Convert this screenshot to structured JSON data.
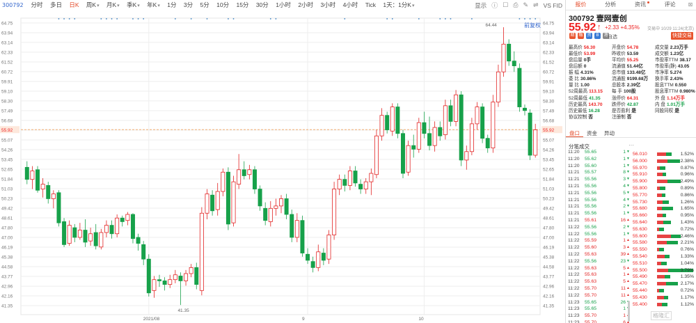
{
  "toolbar": {
    "code": "300792",
    "periods": [
      "分时",
      "多日",
      "日K",
      "周K",
      "月K",
      "季K",
      "年K",
      "1分",
      "3分",
      "5分",
      "10分",
      "15分",
      "30分",
      "1小时",
      "2小时",
      "3小时",
      "4小时",
      "Tick",
      "1天：1分K"
    ],
    "active_period": "日K",
    "display_label": "显示",
    "caret_periods": [
      "周K",
      "月K",
      "季K",
      "年K",
      "1天：1分K"
    ],
    "icons": [
      "info-icon",
      "camera-icon",
      "brush-icon",
      "compare-icon"
    ],
    "vs_label": "VS FID",
    "fuquan_label": "前复权"
  },
  "chart_data": {
    "type": "candlestick",
    "y_ticks": [
      "64.75",
      "63.94",
      "63.14",
      "62.33",
      "61.52",
      "60.72",
      "59.91",
      "59.10",
      "58.30",
      "57.49",
      "56.68",
      "55.88",
      "55.07",
      "54.26",
      "53.45",
      "52.65",
      "51.84",
      "51.03",
      "50.23",
      "49.42",
      "48.61",
      "47.80",
      "47.00",
      "46.19",
      "45.38",
      "44.58",
      "43.77",
      "42.96",
      "42.16",
      "41.35"
    ],
    "ylim": [
      41.35,
      64.75
    ],
    "x_labels": [
      "2021/08",
      "9",
      "10"
    ],
    "current_price_label": "55.92",
    "max_label": "64.44",
    "min_label": "41.35",
    "candles": [
      {
        "o": 52.8,
        "c": 51.8,
        "h": 53.3,
        "l": 51.4
      },
      {
        "o": 51.8,
        "c": 52.5,
        "h": 52.9,
        "l": 51.0
      },
      {
        "o": 52.6,
        "c": 50.9,
        "h": 52.9,
        "l": 50.7
      },
      {
        "o": 51.0,
        "c": 51.4,
        "h": 51.9,
        "l": 50.3
      },
      {
        "o": 51.3,
        "c": 50.2,
        "h": 51.6,
        "l": 49.8
      },
      {
        "o": 50.2,
        "c": 50.6,
        "h": 50.9,
        "l": 49.4
      },
      {
        "o": 50.7,
        "c": 48.2,
        "h": 50.9,
        "l": 47.9
      },
      {
        "o": 48.3,
        "c": 46.4,
        "h": 48.6,
        "l": 46.2
      },
      {
        "o": 46.5,
        "c": 48.0,
        "h": 48.4,
        "l": 46.3
      },
      {
        "o": 47.8,
        "c": 47.0,
        "h": 48.1,
        "l": 46.6
      },
      {
        "o": 47.0,
        "c": 47.6,
        "h": 48.2,
        "l": 46.8
      },
      {
        "o": 47.6,
        "c": 46.6,
        "h": 48.5,
        "l": 46.2
      },
      {
        "o": 46.7,
        "c": 47.3,
        "h": 47.8,
        "l": 46.3
      },
      {
        "o": 47.4,
        "c": 46.3,
        "h": 48.1,
        "l": 46.0
      },
      {
        "o": 46.2,
        "c": 47.4,
        "h": 47.7,
        "l": 46.0
      },
      {
        "o": 47.4,
        "c": 48.0,
        "h": 48.4,
        "l": 47.0
      },
      {
        "o": 48.0,
        "c": 47.3,
        "h": 48.4,
        "l": 46.9
      },
      {
        "o": 47.3,
        "c": 48.6,
        "h": 48.9,
        "l": 47.0
      },
      {
        "o": 48.6,
        "c": 48.3,
        "h": 48.8,
        "l": 47.9
      },
      {
        "o": 48.4,
        "c": 48.9,
        "h": 49.1,
        "l": 48.0
      },
      {
        "o": 48.9,
        "c": 46.9,
        "h": 49.0,
        "l": 46.5
      },
      {
        "o": 47.0,
        "c": 46.5,
        "h": 47.3,
        "l": 45.9
      },
      {
        "o": 46.4,
        "c": 45.2,
        "h": 46.7,
        "l": 44.7
      },
      {
        "o": 45.2,
        "c": 42.4,
        "h": 45.6,
        "l": 42.1
      },
      {
        "o": 42.6,
        "c": 43.5,
        "h": 43.8,
        "l": 42.0
      },
      {
        "o": 43.5,
        "c": 43.4,
        "h": 43.9,
        "l": 42.9
      },
      {
        "o": 43.4,
        "c": 43.1,
        "h": 43.7,
        "l": 42.6
      },
      {
        "o": 43.1,
        "c": 43.5,
        "h": 43.9,
        "l": 42.8
      },
      {
        "o": 43.5,
        "c": 43.9,
        "h": 44.3,
        "l": 43.2
      },
      {
        "o": 43.8,
        "c": 43.4,
        "h": 44.1,
        "l": 41.4
      },
      {
        "o": 43.4,
        "c": 44.0,
        "h": 44.3,
        "l": 43.0
      },
      {
        "o": 44.0,
        "c": 44.5,
        "h": 44.8,
        "l": 43.7
      },
      {
        "o": 44.5,
        "c": 43.1,
        "h": 44.9,
        "l": 42.7
      },
      {
        "o": 42.6,
        "c": 49.0,
        "h": 49.5,
        "l": 42.2
      },
      {
        "o": 49.0,
        "c": 50.6,
        "h": 51.0,
        "l": 48.5
      },
      {
        "o": 50.5,
        "c": 49.2,
        "h": 50.9,
        "l": 48.8
      },
      {
        "o": 49.3,
        "c": 50.8,
        "h": 51.5,
        "l": 48.8
      },
      {
        "o": 50.8,
        "c": 52.4,
        "h": 52.7,
        "l": 50.4
      },
      {
        "o": 52.4,
        "c": 48.1,
        "h": 52.8,
        "l": 47.6
      },
      {
        "o": 48.2,
        "c": 51.6,
        "h": 52.1,
        "l": 47.9
      },
      {
        "o": 51.4,
        "c": 52.6,
        "h": 53.9,
        "l": 51.0
      },
      {
        "o": 52.6,
        "c": 52.1,
        "h": 53.3,
        "l": 51.8
      },
      {
        "o": 52.2,
        "c": 52.6,
        "h": 53.0,
        "l": 51.8
      },
      {
        "o": 52.6,
        "c": 51.0,
        "h": 52.9,
        "l": 50.6
      },
      {
        "o": 51.0,
        "c": 49.6,
        "h": 51.3,
        "l": 49.2
      },
      {
        "o": 49.4,
        "c": 48.4,
        "h": 49.9,
        "l": 48.0
      },
      {
        "o": 48.3,
        "c": 49.4,
        "h": 50.0,
        "l": 47.9
      },
      {
        "o": 49.4,
        "c": 49.6,
        "h": 50.2,
        "l": 48.8
      },
      {
        "o": 49.6,
        "c": 50.2,
        "h": 50.5,
        "l": 49.0
      },
      {
        "o": 50.2,
        "c": 48.9,
        "h": 50.6,
        "l": 48.5
      },
      {
        "o": 48.9,
        "c": 47.0,
        "h": 49.3,
        "l": 46.6
      },
      {
        "o": 47.0,
        "c": 48.4,
        "h": 49.0,
        "l": 46.6
      },
      {
        "o": 48.4,
        "c": 45.7,
        "h": 48.8,
        "l": 45.4
      },
      {
        "o": 45.6,
        "c": 45.1,
        "h": 46.1,
        "l": 44.8
      },
      {
        "o": 45.0,
        "c": 44.5,
        "h": 45.4,
        "l": 44.1
      },
      {
        "o": 44.5,
        "c": 45.8,
        "h": 46.4,
        "l": 44.2
      },
      {
        "o": 45.7,
        "c": 45.1,
        "h": 46.1,
        "l": 44.7
      },
      {
        "o": 45.2,
        "c": 47.2,
        "h": 47.6,
        "l": 44.8
      },
      {
        "o": 47.2,
        "c": 51.0,
        "h": 51.6,
        "l": 46.8
      },
      {
        "o": 51.0,
        "c": 51.8,
        "h": 52.2,
        "l": 50.5
      },
      {
        "o": 51.8,
        "c": 51.3,
        "h": 52.2,
        "l": 50.8
      },
      {
        "o": 51.3,
        "c": 52.5,
        "h": 52.9,
        "l": 50.9
      },
      {
        "o": 52.5,
        "c": 51.5,
        "h": 52.9,
        "l": 51.2
      },
      {
        "o": 51.4,
        "c": 51.0,
        "h": 51.8,
        "l": 50.6
      },
      {
        "o": 51.0,
        "c": 51.6,
        "h": 51.9,
        "l": 50.6
      },
      {
        "o": 51.6,
        "c": 52.3,
        "h": 52.7,
        "l": 50.5
      },
      {
        "o": 52.2,
        "c": 55.4,
        "h": 55.9,
        "l": 51.9
      },
      {
        "o": 55.4,
        "c": 57.1,
        "h": 57.7,
        "l": 55.0
      },
      {
        "o": 57.1,
        "c": 55.9,
        "h": 57.4,
        "l": 55.6
      },
      {
        "o": 55.8,
        "c": 57.8,
        "h": 58.1,
        "l": 55.4
      },
      {
        "o": 57.8,
        "c": 55.6,
        "h": 58.1,
        "l": 55.2
      },
      {
        "o": 55.6,
        "c": 52.3,
        "h": 55.9,
        "l": 51.9
      },
      {
        "o": 52.4,
        "c": 54.6,
        "h": 55.0,
        "l": 52.1
      },
      {
        "o": 54.6,
        "c": 54.3,
        "h": 55.5,
        "l": 53.6
      },
      {
        "o": 54.3,
        "c": 56.5,
        "h": 56.9,
        "l": 54.0
      },
      {
        "o": 56.5,
        "c": 55.6,
        "h": 57.4,
        "l": 55.2
      },
      {
        "o": 55.6,
        "c": 54.6,
        "h": 57.0,
        "l": 54.2
      },
      {
        "o": 54.6,
        "c": 56.1,
        "h": 56.6,
        "l": 54.1
      },
      {
        "o": 56.1,
        "c": 55.4,
        "h": 56.6,
        "l": 55.0
      },
      {
        "o": 55.5,
        "c": 57.9,
        "h": 58.4,
        "l": 55.1
      },
      {
        "o": 57.9,
        "c": 56.6,
        "h": 58.4,
        "l": 56.2
      },
      {
        "o": 56.6,
        "c": 58.8,
        "h": 59.2,
        "l": 56.2
      },
      {
        "o": 58.8,
        "c": 53.4,
        "h": 59.1,
        "l": 52.9
      },
      {
        "o": 53.4,
        "c": 54.1,
        "h": 54.6,
        "l": 52.6
      },
      {
        "o": 54.1,
        "c": 56.4,
        "h": 56.9,
        "l": 53.8
      },
      {
        "o": 56.4,
        "c": 57.8,
        "h": 58.2,
        "l": 55.9
      },
      {
        "o": 57.8,
        "c": 55.2,
        "h": 58.1,
        "l": 54.8
      },
      {
        "o": 55.2,
        "c": 54.4,
        "h": 55.5,
        "l": 54.0
      },
      {
        "o": 54.4,
        "c": 58.2,
        "h": 58.8,
        "l": 54.0
      },
      {
        "o": 58.2,
        "c": 60.7,
        "h": 61.3,
        "l": 57.8
      },
      {
        "o": 60.7,
        "c": 63.0,
        "h": 64.4,
        "l": 60.3
      },
      {
        "o": 63.0,
        "c": 61.6,
        "h": 63.4,
        "l": 61.2
      },
      {
        "o": 61.6,
        "c": 61.2,
        "h": 62.4,
        "l": 60.7
      },
      {
        "o": 61.0,
        "c": 57.8,
        "h": 61.4,
        "l": 57.4
      },
      {
        "o": 57.7,
        "c": 57.5,
        "h": 58.0,
        "l": 57.1
      },
      {
        "o": 57.3,
        "c": 53.8,
        "h": 57.6,
        "l": 53.4
      },
      {
        "o": 53.8,
        "c": 55.9,
        "h": 56.4,
        "l": 53.6
      }
    ]
  },
  "quote": {
    "name": "300792  壹网壹创",
    "price": "55.92",
    "arrow": "↑",
    "change": "+2.33  +4.35%",
    "time": "交易中 10/29 11:24(北京)",
    "badges": [
      "期",
      "融",
      "资",
      "B",
      "港"
    ],
    "badge_colors": [
      "#e8552e",
      "#e8552e",
      "#3a7bd5",
      "#3a7bd5",
      "#888888"
    ],
    "badge_label": "自选",
    "trade_button": "快捷交易"
  },
  "stats": [
    [
      "最高价",
      "56.30",
      "red",
      "开盘价",
      "54.78",
      "red",
      "成交量",
      "2.23万手",
      "bold"
    ],
    [
      "最低价",
      "53.99",
      "red",
      "昨收价",
      "53.59",
      "",
      "成交额",
      "1.23亿",
      "bold"
    ],
    [
      "盘后量",
      "0手",
      "",
      "平均价",
      "55.25",
      "red",
      "市盈率TTM",
      "38.17",
      "bold"
    ],
    [
      "盘后额",
      "0",
      "",
      "流通值",
      "51.44亿",
      "",
      "市盈率(静)",
      "43.05",
      "bold"
    ],
    [
      "振  幅",
      "4.31%",
      "",
      "总市值",
      "133.48亿",
      "",
      "市净率",
      "5.274",
      "bold"
    ],
    [
      "委  比",
      "30.86%",
      "",
      "流通股",
      "9199.68万",
      "",
      "换手率",
      "2.43%",
      "bold"
    ],
    [
      "量  比",
      "1.00",
      "",
      "总股本",
      "2.39亿",
      "",
      "股息TTM",
      "0.550",
      "bold"
    ],
    [
      "52周最高",
      "113.15",
      "red",
      "每  手",
      "100股",
      "",
      "股息率TTM",
      "0.980%",
      "bold"
    ],
    [
      "52周最低",
      "41.35",
      "green",
      "涨停价",
      "64.31",
      "red",
      "外  盘",
      "1.14万手",
      "red"
    ],
    [
      "历史最高",
      "143.70",
      "red",
      "跌停价",
      "42.87",
      "green",
      "内  盘",
      "1.01万手",
      "green"
    ],
    [
      "历史最低",
      "16.28",
      "green",
      "是否盈利",
      "是",
      "",
      "同股同权",
      "是",
      "bold"
    ],
    [
      "协议控制",
      "否",
      "",
      "注册制",
      "否",
      "",
      "",
      "",
      ""
    ]
  ],
  "tabs": [
    "报价",
    "分析",
    "资讯",
    "评论"
  ],
  "subtabs": [
    "盘口",
    "资金",
    "异动"
  ],
  "trades_title": "分笔成交",
  "trades": [
    [
      "11:20",
      "55.65",
      "1",
      "-"
    ],
    [
      "11:20",
      "55.62",
      "1",
      "-"
    ],
    [
      "11:20",
      "55.60",
      "1",
      "-"
    ],
    [
      "11:21",
      "55.57",
      "8",
      "-"
    ],
    [
      "11:21",
      "55.56",
      "3",
      "-"
    ],
    [
      "11:21",
      "55.56",
      "4",
      "-"
    ],
    [
      "11:21",
      "55.56",
      "5",
      "-"
    ],
    [
      "11:21",
      "55.56",
      "4",
      "-"
    ],
    [
      "11:21",
      "55.56",
      "2",
      "-"
    ],
    [
      "11:21",
      "55.56",
      "1",
      "-"
    ],
    [
      "11:21",
      "55.61",
      "16",
      "+"
    ],
    [
      "11:22",
      "55.56",
      "2",
      "-"
    ],
    [
      "11:22",
      "55.56",
      "1",
      "-"
    ],
    [
      "11:22",
      "55.59",
      "1",
      "+"
    ],
    [
      "11:22",
      "55.60",
      "3",
      "+"
    ],
    [
      "11:22",
      "55.63",
      "39",
      "+"
    ],
    [
      "11:22",
      "55.56",
      "23",
      "-"
    ],
    [
      "11:22",
      "55.63",
      "5",
      "+"
    ],
    [
      "11:22",
      "55.63",
      "1",
      "+"
    ],
    [
      "11:22",
      "55.63",
      "5",
      "+"
    ],
    [
      "11:22",
      "55.70",
      "11",
      "+"
    ],
    [
      "11:22",
      "55.70",
      "11",
      "+"
    ],
    [
      "11:23",
      "55.65",
      "26",
      "-"
    ],
    [
      "11:23",
      "55.65",
      "1",
      "-"
    ],
    [
      "11:23",
      "55.70",
      "1",
      "+"
    ],
    [
      "11:23",
      "55.70",
      "6",
      "+"
    ]
  ],
  "distribution": [
    [
      "56.010",
      "1.52%"
    ],
    [
      "56.000",
      "2.38%"
    ],
    [
      "55.970",
      "0.87%"
    ],
    [
      "55.910",
      "0.96%"
    ],
    [
      "55.900",
      "2.49%"
    ],
    [
      "55.800",
      "0.89%"
    ],
    [
      "55.770",
      "0.86%"
    ],
    [
      "55.730",
      "1.26%"
    ],
    [
      "55.680",
      "1.65%"
    ],
    [
      "55.660",
      "0.95%"
    ],
    [
      "55.640",
      "1.43%"
    ],
    [
      "55.630",
      "0.72%"
    ],
    [
      "55.600",
      "2.46%"
    ],
    [
      "55.580",
      "2.21%"
    ],
    [
      "55.550",
      "0.76%"
    ],
    [
      "55.540",
      "1.33%"
    ],
    [
      "55.510",
      "1.04%"
    ],
    [
      "55.500",
      "3.79%"
    ],
    [
      "55.490",
      "1.35%"
    ],
    [
      "55.470",
      "2.17%"
    ],
    [
      "55.440",
      "0.72%"
    ],
    [
      "55.430",
      "1.17%"
    ],
    [
      "55.400",
      "1.12%"
    ]
  ],
  "colors": {
    "up": "#e22222",
    "down": "#17a14a",
    "accent": "#e44b2a",
    "grid": "#eeeeee",
    "price_line": "#f5a25d"
  },
  "watermark": "格隆汇"
}
